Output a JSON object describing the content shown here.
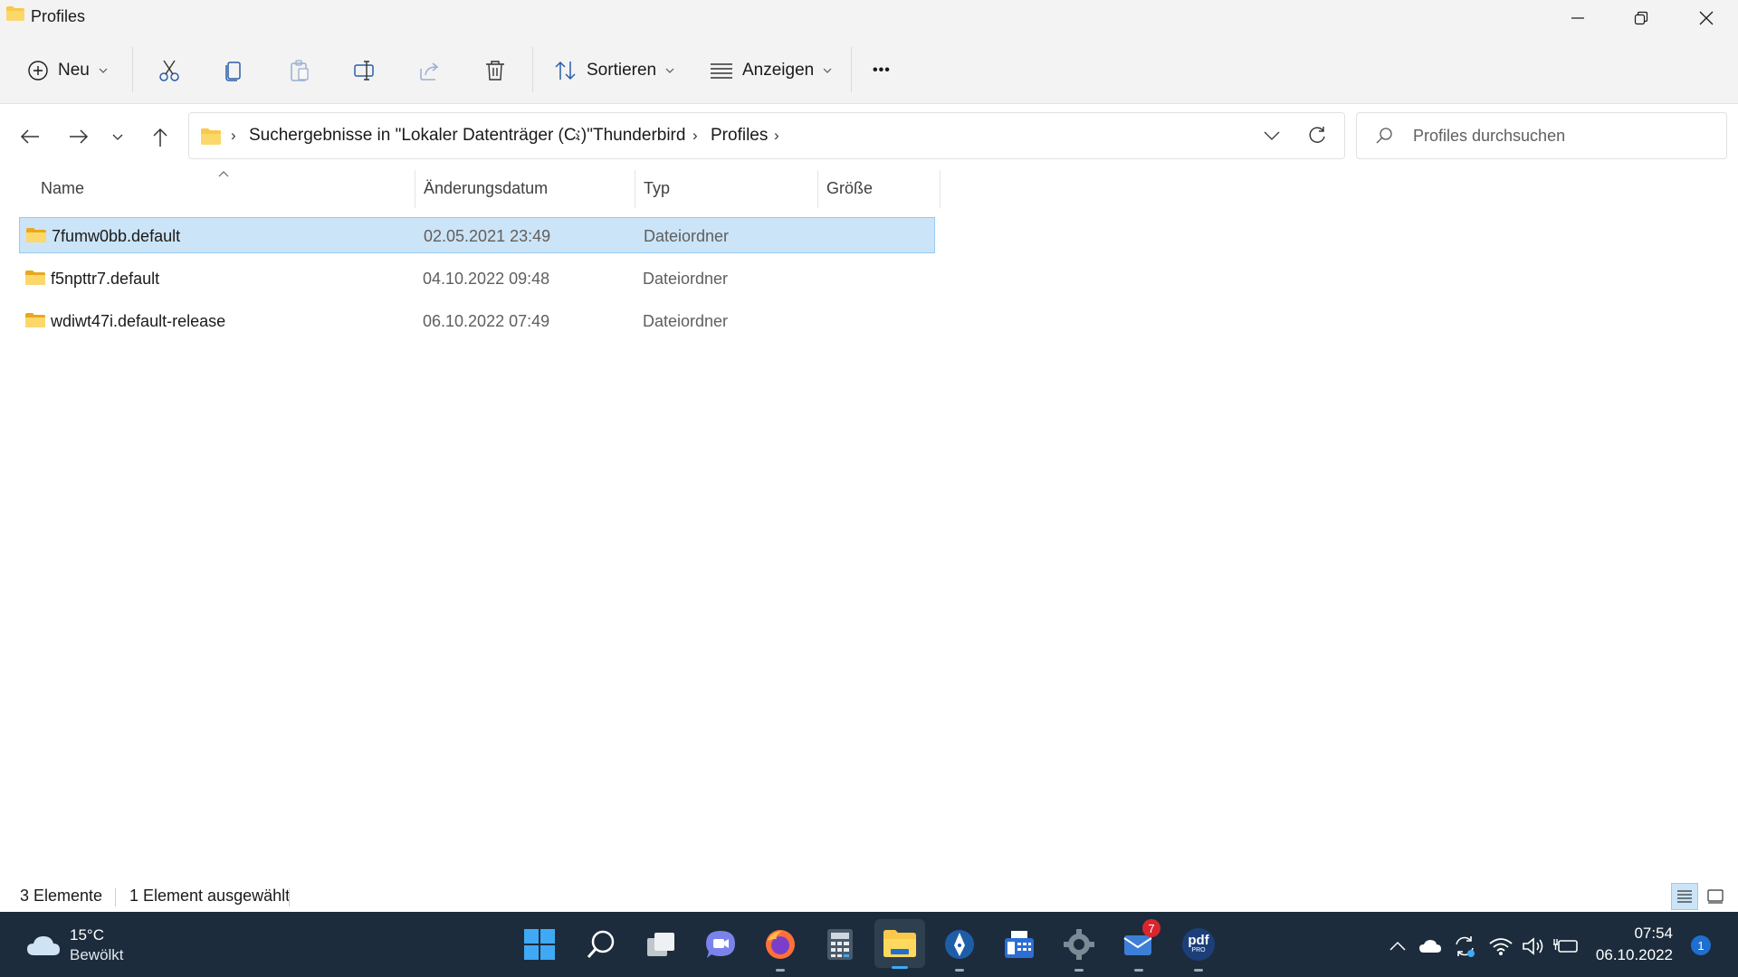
{
  "window": {
    "title": "Profiles"
  },
  "toolbar": {
    "new_label": "Neu",
    "sort_label": "Sortieren",
    "view_label": "Anzeigen",
    "more_label": "•••"
  },
  "nav": {
    "breadcrumb": [
      "Suchergebnisse in \"Lokaler Datenträger (C:)\"",
      "Thunderbird",
      "Profiles"
    ],
    "search_placeholder": "Profiles durchsuchen"
  },
  "columns": {
    "name": "Name",
    "date": "Änderungsdatum",
    "type": "Typ",
    "size": "Größe"
  },
  "files": [
    {
      "name": "7fumw0bb.default",
      "date": "02.05.2021 23:49",
      "type": "Dateiordner",
      "size": "",
      "selected": true
    },
    {
      "name": "f5npttr7.default",
      "date": "04.10.2022 09:48",
      "type": "Dateiordner",
      "size": "",
      "selected": false
    },
    {
      "name": "wdiwt47i.default-release",
      "date": "06.10.2022 07:49",
      "type": "Dateiordner",
      "size": "",
      "selected": false
    }
  ],
  "status": {
    "count": "3 Elemente",
    "selection": "1 Element ausgewählt"
  },
  "taskbar": {
    "weather_temp": "15°C",
    "weather_desc": "Bewölkt",
    "mail_badge": "7",
    "pdf_label": "pdf",
    "pdf_sub": "PRO",
    "time": "07:54",
    "date": "06.10.2022",
    "notification_count": "1"
  },
  "colors": {
    "selection": "#cce4f7",
    "taskbar": "#1c2c3c",
    "folder": "#f8c94b",
    "accent": "#0067c0"
  }
}
